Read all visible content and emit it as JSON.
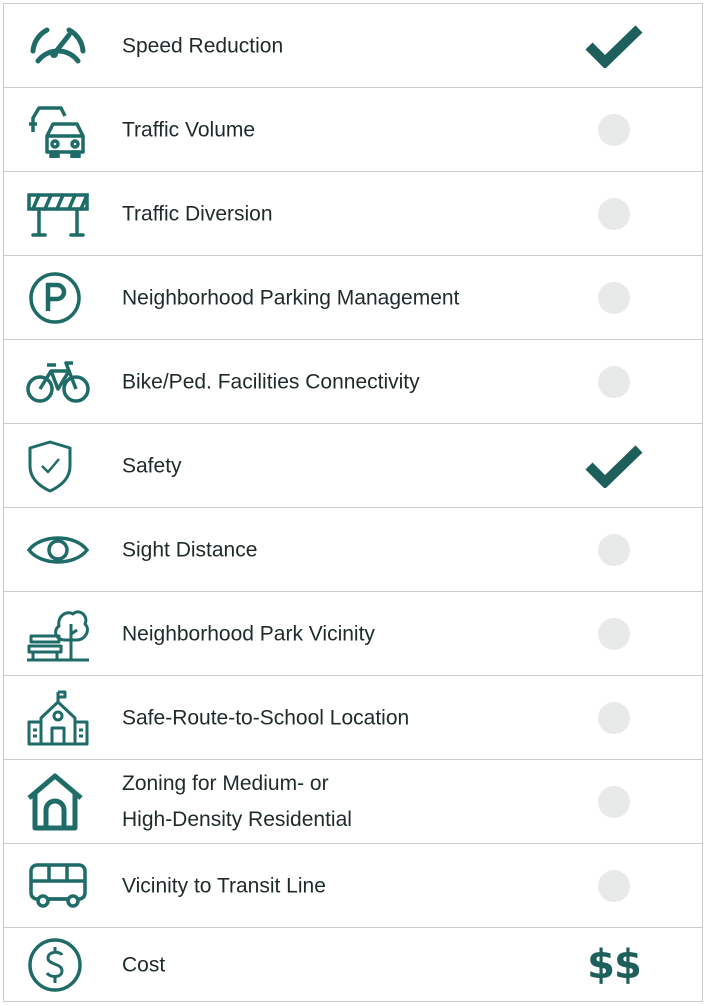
{
  "accent_color": "#1e6b67",
  "check_color": "#1e5f5b",
  "inactive_color": "#e8e9e9",
  "rows": [
    {
      "label": "Speed Reduction",
      "icon": "speedometer-icon",
      "status": "check"
    },
    {
      "label": "Traffic Volume",
      "icon": "two-cars-icon",
      "status": "none"
    },
    {
      "label": "Traffic Diversion",
      "icon": "road-barrier-icon",
      "status": "none"
    },
    {
      "label": "Neighborhood Parking Management",
      "icon": "parking-icon",
      "status": "none"
    },
    {
      "label": "Bike/Ped. Facilities Connectivity",
      "icon": "bicycle-icon",
      "status": "none"
    },
    {
      "label": "Safety",
      "icon": "shield-check-icon",
      "status": "check"
    },
    {
      "label": "Sight Distance",
      "icon": "eye-icon",
      "status": "none"
    },
    {
      "label": "Neighborhood Park Vicinity",
      "icon": "park-bench-tree-icon",
      "status": "none"
    },
    {
      "label": "Safe-Route-to-School Location",
      "icon": "school-icon",
      "status": "none"
    },
    {
      "label_line1": "Zoning for Medium- or",
      "label_line2": "High-Density Residential",
      "icon": "house-icon",
      "status": "none"
    },
    {
      "label": "Vicinity to Transit Line",
      "icon": "bus-icon",
      "status": "none"
    },
    {
      "label": "Cost",
      "icon": "dollar-coin-icon",
      "status": "money",
      "status_text": "$$"
    }
  ]
}
